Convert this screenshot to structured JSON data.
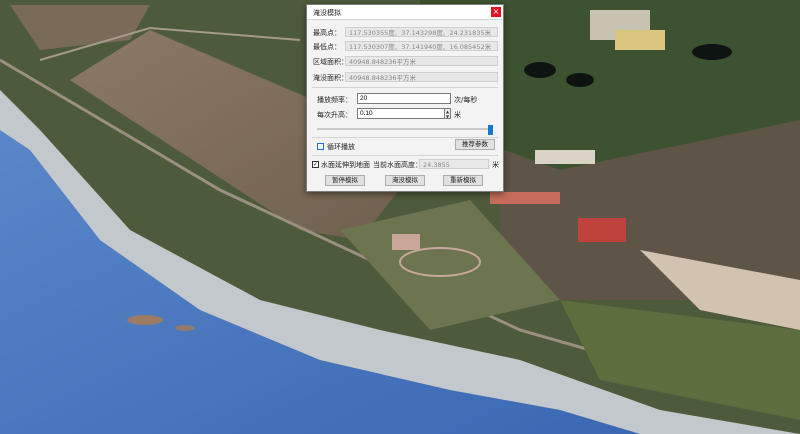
{
  "dialog": {
    "title": "淹没模拟",
    "close": "×",
    "highest_point_label": "最高点：",
    "highest_point_value": "117.530355度、37.143298度、24.231835米",
    "lowest_point_label": "最低点：",
    "lowest_point_value": "117.530307度、37.141940度、16.085452米",
    "region_area_label": "区域面积：",
    "region_area_value": "40948.848236平方米",
    "flood_area_label": "淹没面积：",
    "flood_area_value": "40948.848236平方米",
    "play_rate_label": "播放频率：",
    "play_rate_value": "20",
    "play_rate_unit": "次/每秒",
    "rise_label": "每次升高：",
    "rise_value": "0.10",
    "rise_unit": "米",
    "slider_level": 1.0,
    "loop_label": "循环播放",
    "loop_checked": false,
    "recommend_button": "推荐参数",
    "water_to_ground_label": "水面延伸到地面",
    "water_to_ground_checked": true,
    "current_height_label": "当前水面高度：",
    "current_height_value": "24.3855",
    "current_height_unit": "米",
    "pause_button": "暂停模拟",
    "simulate_button": "淹没模拟",
    "restart_button": "重新模拟"
  },
  "colors": {
    "water": "#3f6fb8",
    "farmland": "#7b6a58",
    "vegetation": "#3c5a2a",
    "slider_thumb": "#1976d2",
    "close_button": "#e81123"
  }
}
